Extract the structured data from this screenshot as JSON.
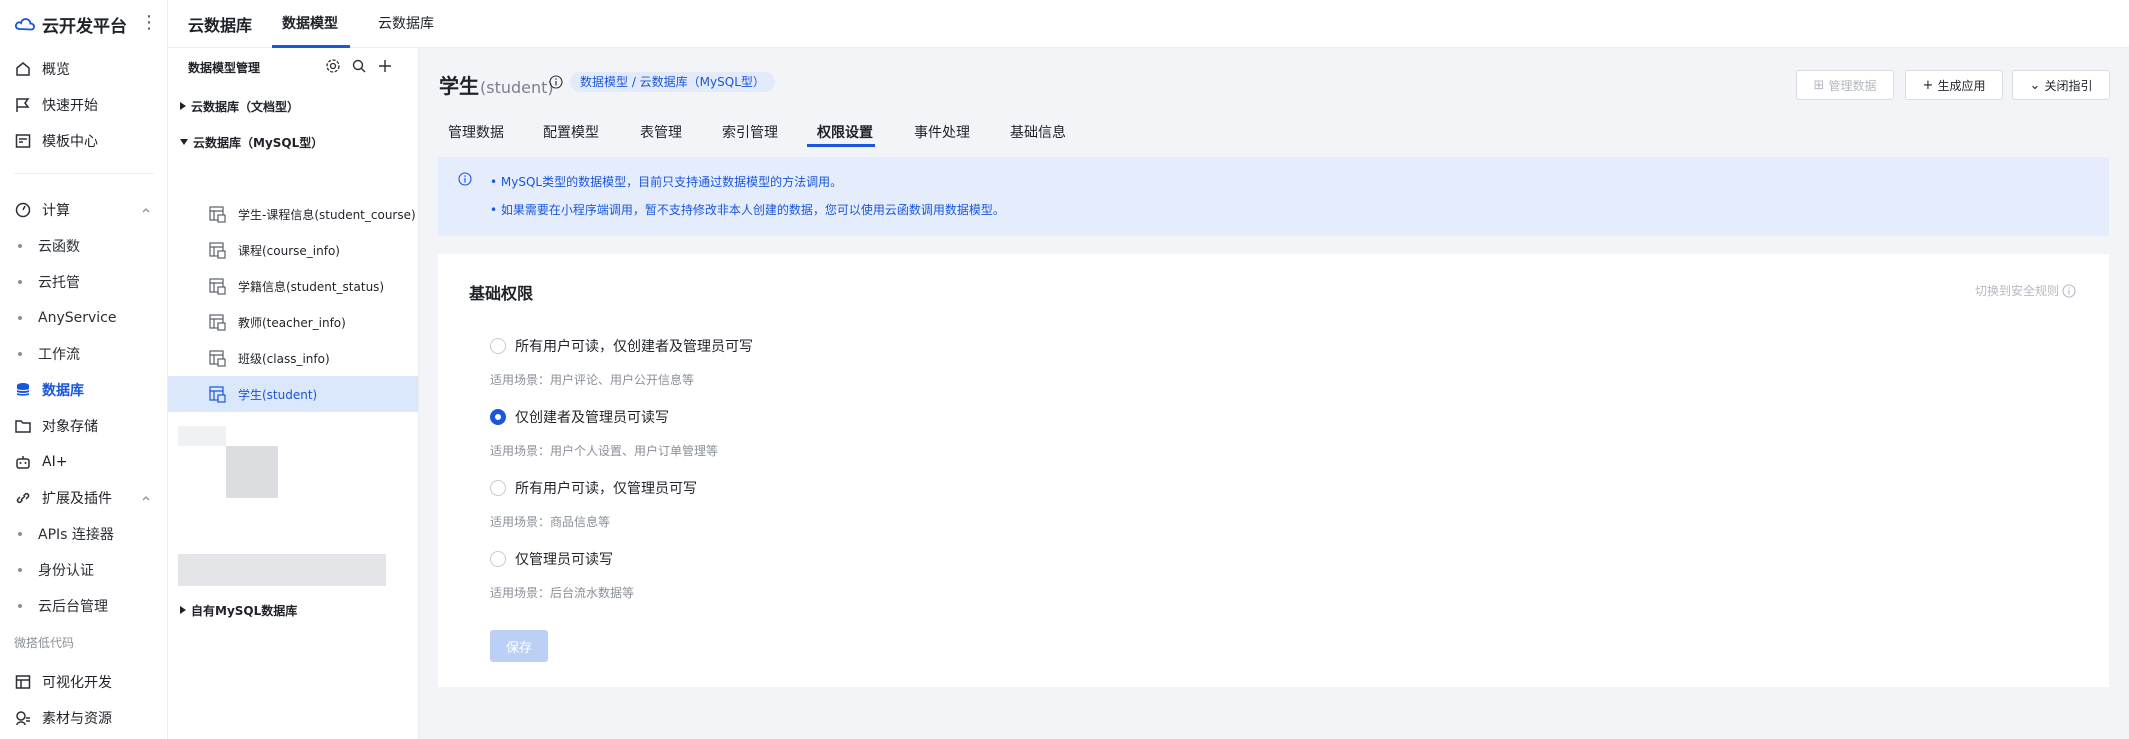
{
  "brand": {
    "name": "云开发平台"
  },
  "nav": {
    "items": [
      {
        "key": "overview",
        "label": "概览",
        "icon": "home-icon"
      },
      {
        "key": "quickstart",
        "label": "快速开始",
        "icon": "flag-icon"
      },
      {
        "key": "templates",
        "label": "模板中心",
        "icon": "template-icon"
      }
    ],
    "compute": {
      "label": "计算",
      "icon": "gauge-icon",
      "subs": [
        "云函数",
        "云托管",
        "AnyService",
        "工作流"
      ]
    },
    "database": {
      "label": "数据库",
      "icon": "database-icon"
    },
    "storage": {
      "label": "对象存储",
      "icon": "folder-icon"
    },
    "ai": {
      "label": "AI+",
      "icon": "robot-icon"
    },
    "ext": {
      "label": "扩展及插件",
      "icon": "link-icon",
      "subs": [
        "APIs 连接器",
        "身份认证",
        "云后台管理"
      ]
    },
    "lowcode_title": "微搭低代码",
    "visual": {
      "label": "可视化开发",
      "icon": "layout-icon"
    },
    "assets": {
      "label": "素材与资源",
      "icon": "assets-icon"
    }
  },
  "topbar": {
    "title": "云数据库",
    "tabs": [
      "数据模型",
      "云数据库"
    ]
  },
  "tree": {
    "title": "数据模型管理",
    "groups": [
      "云数据库（文档型）",
      "云数据库（MySQL型）",
      "自有MySQL数据库"
    ],
    "nodes": [
      "学生-课程信息(student_course)",
      "课程(course_info)",
      "学籍信息(student_status)",
      "教师(teacher_info)",
      "班级(class_info)",
      "学生(student)"
    ]
  },
  "page": {
    "title": "学生",
    "title_sub": "(student)",
    "crumb": "数据模型 / 云数据库（MySQL型）",
    "buttons": {
      "manage": "管理数据",
      "generate": "生成应用",
      "close_guide": "关闭指引"
    },
    "tabs": [
      "管理数据",
      "配置模型",
      "表管理",
      "索引管理",
      "权限设置",
      "事件处理",
      "基础信息"
    ],
    "notice": [
      "• MySQL类型的数据模型，目前只支持通过数据模型的方法调用。",
      "• 如果需要在小程序端调用，暂不支持修改非本人创建的数据，您可以使用云函数调用数据模型。"
    ],
    "card": {
      "title": "基础权限",
      "switch_link": "切换到安全规则",
      "options": [
        {
          "label": "所有用户可读，仅创建者及管理员可写",
          "scene": "适用场景：用户评论、用户公开信息等",
          "checked": false
        },
        {
          "label": "仅创建者及管理员可读写",
          "scene": "适用场景：用户个人设置、用户订单管理等",
          "checked": true
        },
        {
          "label": "所有用户可读，仅管理员可写",
          "scene": "适用场景：商品信息等",
          "checked": false
        },
        {
          "label": "仅管理员可读写",
          "scene": "适用场景：后台流水数据等",
          "checked": false
        }
      ],
      "save": "保存"
    }
  },
  "colors": {
    "accent": "#1a56db",
    "accent_light": "#dbe7fb",
    "notice_bg": "#e5edfc"
  }
}
